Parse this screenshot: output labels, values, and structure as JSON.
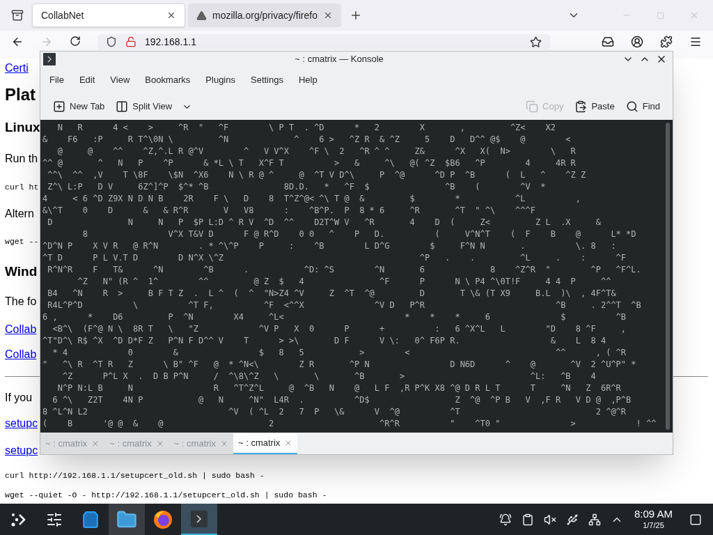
{
  "browser": {
    "tabs": [
      {
        "title": "CollabNet",
        "selected": true,
        "warning": false
      },
      {
        "title": "mozilla.org/privacy/firefo",
        "selected": false,
        "warning": true
      }
    ],
    "forward_disabled": true,
    "address": "192.168.1.1"
  },
  "page": {
    "items": [
      {
        "kind": "link",
        "text": "Certi"
      },
      {
        "kind": "heading",
        "text": "Plat"
      },
      {
        "kind": "subheading",
        "text": "Linux"
      },
      {
        "kind": "text",
        "text": "Run th"
      },
      {
        "kind": "code",
        "text": "curl ht"
      },
      {
        "kind": "text",
        "text": "Altern"
      },
      {
        "kind": "code",
        "text": "wget --"
      },
      {
        "kind": "subheading",
        "text": "Wind"
      },
      {
        "kind": "text",
        "text": "The fo"
      },
      {
        "kind": "link",
        "text": "Collab"
      },
      {
        "kind": "link",
        "text": "Collab"
      },
      {
        "kind": "rule"
      },
      {
        "kind": "text",
        "text": "If you"
      },
      {
        "kind": "link",
        "text": "setupc"
      },
      {
        "kind": "link",
        "text": "setupc"
      },
      {
        "kind": "code",
        "text": "curl http://192.168.1.1/setupcert_old.sh | sudo bash -"
      },
      {
        "kind": "code",
        "text": "wget --quiet -O - http://192.168.1.1/setupcert_old.sh | sudo bash -"
      }
    ]
  },
  "konsole": {
    "title": "~ : cmatrix — Konsole",
    "menu": [
      "File",
      "Edit",
      "View",
      "Bookmarks",
      "Plugins",
      "Settings",
      "Help"
    ],
    "toolbar": [
      {
        "kind": "new-tab",
        "label": "New Tab",
        "disabled": false
      },
      {
        "kind": "split",
        "label": "Split View",
        "disabled": false
      },
      {
        "kind": "copy",
        "label": "Copy",
        "disabled": true
      },
      {
        "kind": "paste",
        "label": "Paste",
        "disabled": false
      },
      {
        "kind": "find",
        "label": "Find",
        "disabled": false
      }
    ],
    "lines": [
      "   N   R      4 <    >     ^R  \"   ^F        \\ P T  . ^D      *   2        X       ,         ^Z<    X2",
      "&    F6   :P     R T^\\0N \\         ^N             ^    6 >   ^Z R  & ^Z     5    D   D^^ @$    @        <",
      "   @     @    ^^    ^Z,^.L R @^V        ^   V V^X    ^F \\  2   ^R ^ ^     Z&      ^X   X(  N>        \\   R",
      "^^ @       ^   N   P    ^P      & *L \\ T   X^F T          >   &     ^\\   @( ^Z  $B6   ^P        4     4R R",
      " ^^\\  ^^  ,V    T \\8F    \\$N  ^X6    N \\ R @ ^     @  ^T V D^\\     P  ^@      ^D P  ^B      (  L   ^    ^Z Z",
      " Z^\\ L:P   D V     6Z^]^P  $^* ^B               8D.D.   *   ^F  $               ^B    (        ^V  *",
      "4     < 6 ^D Z9X N D N B    2R    F \\   D    8  T^Z^@< ^\\ T @  &         $        *           ^L          ,",
      "&\\^T    0    D      &   & R^R       V   V8      :    ^B^P.  P  8 * 6     ^R       ^T  \" ^\\    ^^^F",
      " D               N     N   P  $P L:D ^ R V  ^D  ^^    D2T^W V   ^R       4    D  (     Z<         Z L  .X     &",
      "        8                V^X T&V D      F @ R^D    0 0   ^    P   D.          (     V^N^T    (  F    B    @      L* *D",
      "^D^N P    X V R   @ R^N        . * ^\\^P    P     :    ^B        L D^G        $     F^N N       .          \\. 8   :",
      "^T D      P L V.T D        D N^X \\^Z                                       ^P   .    .         ^L     .    :      ^F",
      " R^N^R    F   T&      ^N        ^B      .           ^D: ^S        ^N       6             8    ^Z^R  \"        ^P   ^F^L.",
      "       ^Z   N\" (R ^  1^        ^^         @ Z  $   4               ^F      P      N \\ P4 ^\\0T!F     4 4  P     ^^",
      " B4   ^N    R  >     B F T Z  .  L ^  (  ^  \"N>Z4 ^V     Z  ^T  ^@         D       T \\& (T X9     B.L  )\\  , 4F^T&",
      " R4L^P^D          \\          ^T F,          ^F  <^^X              ^V D   P^R                          ^B     . 2^^T  ^B",
      "6 ,      *    D6         P  ^N        X4     ^L<                        *    *    *     6              $          ^B",
      "  <B^\\  (F^@ N \\  8R T   \\   \"Z            ^V P   X  0      P      +          :   6 ^X^L   L        \"D    8 ^F     ,",
      "^T\"D^\\ R$ ^X  ^D D*F Z   P^N F D^^ V    T      > >\\       D F      V \\:   0^ F6P R.                  &    L  8 4",
      "  * 4            0        &                $   8   5           >        <                             ^^      , ( ^R",
      "\"   ^\\ R  ^T R   Z      \\ B\" ^F   @  * ^N<\\        Z R       ^P N                D N6D      ^    @       ^V  2 ^U^P\" *",
      "    ^Z      P^L X  .  D B P^N     /  ^\\8\\^Z   \\       \\       ^B       >                         ^L:   ^B    4",
      "   N^P N:L B     N                R   ^T^Z^L     @  ^B   N    @   L F  ,R P^K X8 ^@ D R L T      T     ^N   Z  6R^R",
      "  6 ^\\   Z2T    4N P           @   N     ^N\"  L4R  .          ^D$                 Z  ^@  ^P B   V  ,F R   V D @  ,P^B",
      "8 ^L^N L2                            ^V  ( ^L  2   7  P   \\&      V  ^@          ^T                           2 ^@^R",
      "(    B      '@ @  &    @                     2                     ^R^R          \"    ^T0 \"              >            ! ^^"
    ],
    "tabs": [
      {
        "title": "~ : cmatrix",
        "selected": false
      },
      {
        "title": "~ : cmatrix",
        "selected": false
      },
      {
        "title": "~ : cmatrix",
        "selected": false
      },
      {
        "title": "~ : cmatrix",
        "selected": true
      }
    ]
  },
  "taskbar": {
    "apps": [
      {
        "kind": "launcher",
        "selected": false,
        "hovered": false
      },
      {
        "kind": "settings",
        "selected": false,
        "hovered": false
      },
      {
        "kind": "store",
        "selected": false,
        "hovered": false
      },
      {
        "kind": "files",
        "selected": false,
        "hovered": true
      },
      {
        "kind": "browser",
        "selected": false,
        "hovered": false
      },
      {
        "kind": "terminal",
        "selected": true,
        "hovered": false
      }
    ],
    "tray": [
      {
        "kind": "notifications"
      },
      {
        "kind": "clipboard"
      },
      {
        "kind": "volume-muted"
      },
      {
        "kind": "usb"
      },
      {
        "kind": "network"
      },
      {
        "kind": "expand"
      }
    ],
    "time": "8:09 AM",
    "date": "1/7/25"
  }
}
